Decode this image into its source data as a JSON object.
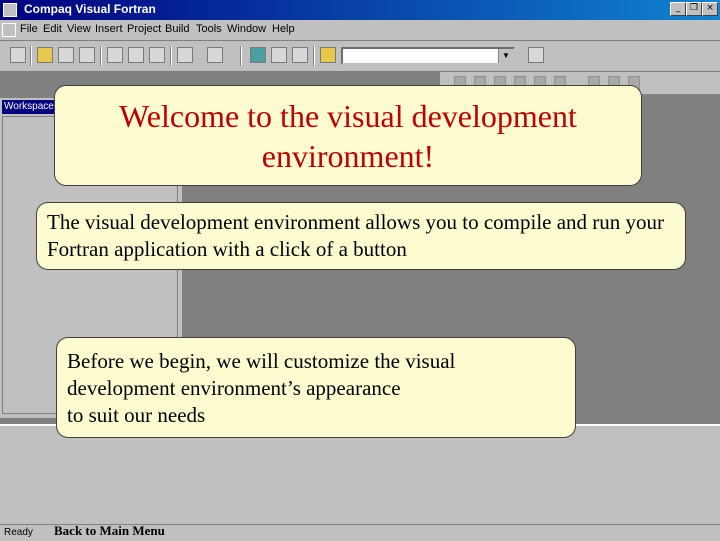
{
  "window": {
    "title": "Compaq Visual Fortran"
  },
  "window_controls": {
    "minimize": "_",
    "restore": "❐",
    "close": "×"
  },
  "menu": [
    "File",
    "Edit",
    "View",
    "Insert",
    "Project",
    "Build",
    "Tools",
    "Window",
    "Help"
  ],
  "workspace": {
    "title": "Workspace"
  },
  "status": {
    "text": "Ready"
  },
  "callouts": {
    "welcome": "Welcome to the visual development environment!",
    "intro": "The visual development environment allows you to compile and run your Fortran application with a click of a button",
    "customize_line1": "Before we begin, we will customize the visual",
    "customize_line2": "development environment’s appearance",
    "customize_line3": "to suit our needs"
  },
  "nav": {
    "back": "Back to Main Menu"
  },
  "colors": {
    "titlebar": "#000080",
    "callout_bg": "#fdfbd0",
    "welcome_text": "#c00000"
  }
}
